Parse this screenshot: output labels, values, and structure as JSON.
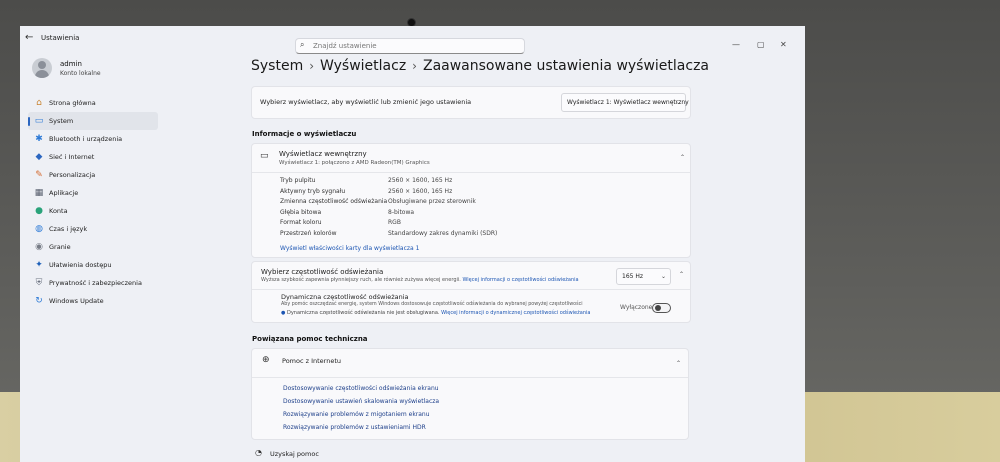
{
  "window": {
    "title": "Ustawienia",
    "back_icon": "back-arrow-icon",
    "controls": [
      "—",
      "▢",
      "✕"
    ]
  },
  "search": {
    "placeholder": "Znajdź ustawienie"
  },
  "user": {
    "name": "admin",
    "account": "Konto lokalne"
  },
  "sidebar": {
    "items": [
      {
        "label": "Strona główna",
        "icon": "home-icon",
        "glyph": "⌂",
        "color": "#c9832f"
      },
      {
        "label": "System",
        "icon": "system-icon",
        "glyph": "▭",
        "color": "#2d7ad6",
        "active": true
      },
      {
        "label": "Bluetooth i urządzenia",
        "icon": "bluetooth-icon",
        "glyph": "✱",
        "color": "#2d7ad6"
      },
      {
        "label": "Sieć i Internet",
        "icon": "wifi-icon",
        "glyph": "◆",
        "color": "#2b66c0"
      },
      {
        "label": "Personalizacja",
        "icon": "brush-icon",
        "glyph": "✎",
        "color": "#d46a2f"
      },
      {
        "label": "Aplikacje",
        "icon": "apps-icon",
        "glyph": "▦",
        "color": "#555c6b"
      },
      {
        "label": "Konta",
        "icon": "account-icon",
        "glyph": "●",
        "color": "#2aa37a"
      },
      {
        "label": "Czas i język",
        "icon": "globe-clock-icon",
        "glyph": "◍",
        "color": "#2d7ad6"
      },
      {
        "label": "Granie",
        "icon": "gamepad-icon",
        "glyph": "◉",
        "color": "#777c86"
      },
      {
        "label": "Ułatwienia dostępu",
        "icon": "accessibility-icon",
        "glyph": "✦",
        "color": "#1c5fb8"
      },
      {
        "label": "Prywatność i zabezpieczenia",
        "icon": "shield-icon",
        "glyph": "⛨",
        "color": "#6b7280"
      },
      {
        "label": "Windows Update",
        "icon": "update-icon",
        "glyph": "↻",
        "color": "#2d7ad6"
      }
    ]
  },
  "breadcrumb": [
    "System",
    "Wyświetlacz",
    "Zaawansowane ustawienia wyświetlacza"
  ],
  "display_select": {
    "prompt": "Wybierz wyświetlacz, aby wyświetlić lub zmienić jego ustawienia",
    "value": "Wyświetlacz 1: Wyświetlacz wewnętrzny"
  },
  "info": {
    "section_title": "Informacje o wyświetlaczu",
    "display_name": "Wyświetlacz wewnętrzny",
    "display_sub": "Wyświetlacz 1: połączono z AMD Radeon(TM) Graphics",
    "rows": [
      {
        "label": "Tryb pulpitu",
        "value": "2560 × 1600, 165 Hz"
      },
      {
        "label": "Aktywny tryb sygnału",
        "value": "2560 × 1600, 165 Hz"
      },
      {
        "label": "Zmienna częstotliwość odświeżania",
        "value": "Obsługiwane przez sterownik"
      },
      {
        "label": "Głębia bitowa",
        "value": "8-bitowa"
      },
      {
        "label": "Format koloru",
        "value": "RGB"
      },
      {
        "label": "Przestrzeń kolorów",
        "value": "Standardowy zakres dynamiki (SDR)"
      }
    ],
    "adapter_link": "Wyświetl właściwości karty dla wyświetlacza 1"
  },
  "refresh": {
    "title": "Wybierz częstotliwość odświeżania",
    "desc": "Wyższa szybkość zapewnia płynniejszy ruch, ale również zużywa więcej energii.",
    "desc_link": "Więcej informacji o częstotliwości odświeżania",
    "value": "165 Hz",
    "dynamic_title": "Dynamiczna częstotliwość odświeżania",
    "dynamic_desc": "Aby pomóc oszczędzać energię, system Windows dostosowuje częstotliwość odświeżania do wybranej powyżej częstotliwości",
    "dynamic_note": "Dynamiczna częstotliwość odświeżania nie jest obsługiwana.",
    "dynamic_link": "Więcej informacji o dynamicznej częstotliwości odświeżania",
    "toggle_label": "Wyłączone"
  },
  "help": {
    "section_title": "Powiązana pomoc techniczna",
    "card_title": "Pomoc z Internetu",
    "links": [
      "Dostosowywanie częstotliwości odświeżania ekranu",
      "Dostosowywanie ustawień skalowania wyświetlacza",
      "Rozwiązywanie problemów z migotaniem ekranu",
      "Rozwiązywanie problemów z ustawieniami HDR"
    ]
  },
  "get_help": "Uzyskaj pomoc"
}
